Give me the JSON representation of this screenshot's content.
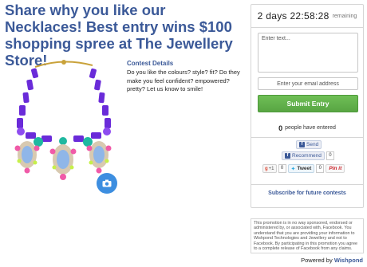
{
  "headline": "Share why you like our Necklaces! Best entry wins $100 shopping spree at The Jewellery Store!",
  "contest": {
    "title": "Contest Details",
    "description": "Do you like the colours? style? fit? Do they make you feel confident? empowered? pretty? Let us know to smile!"
  },
  "timer": {
    "value": "2 days 22:58:28",
    "label": "remaining"
  },
  "form": {
    "entry_placeholder": "Enter text...",
    "email_placeholder": "Enter your email address",
    "submit_label": "Submit Entry"
  },
  "entered": {
    "count": "0",
    "label": "people have entered"
  },
  "share": {
    "send_label": "Send",
    "recommend_label": "Recommend",
    "recommend_count": "0",
    "gplus_label": "+1",
    "gplus_count": "0",
    "tweet_label": "Tweet",
    "tweet_count": "0",
    "pinit_label": "Pin it"
  },
  "subscribe_label": "Subscribe for future contests",
  "disclaimer": "This promotion is in no way sponsored, endorsed or administered by, or associated with, Facebook. You understand that you are providing your information to Wishpond Technologies and Jewellery and not to Facebook. By participating in this promotion you agree to a complete release of Facebook from any claims.",
  "powered": {
    "prefix": "Powered by",
    "brand": "Wishpond"
  },
  "colors": {
    "headline": "#3b5998",
    "submit": "#5cab46",
    "camera": "#3d8ee0"
  }
}
